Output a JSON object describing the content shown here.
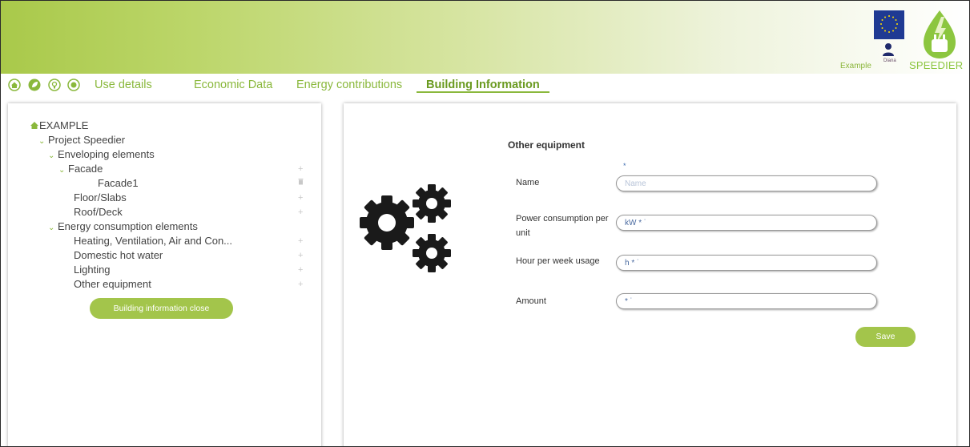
{
  "header": {
    "user_name": "Diana",
    "project_label": "Example",
    "brand_name": "SPEEDIER",
    "colors": {
      "accent": "#8ab83c",
      "button": "#a3c54b",
      "eu_blue": "#1f3a93"
    }
  },
  "nav": {
    "icons": [
      "home-icon",
      "leaf-icon",
      "lightbulb-icon",
      "power-icon"
    ],
    "links": [
      {
        "label": "Use details"
      },
      {
        "label": "Economic Data"
      },
      {
        "label": "Energy contributions"
      },
      {
        "label": "Building Information",
        "active": true
      }
    ]
  },
  "tree": {
    "root": "EXAMPLE",
    "project": "Project Speedier",
    "enveloping": "Enveloping elements",
    "facade": "Facade",
    "facade1": "Facade1",
    "floor": "Floor/Slabs",
    "roof": "Roof/Deck",
    "energy": "Energy consumption elements",
    "hvac": "Heating, Ventilation, Air and Con...",
    "dhw": "Domestic hot water",
    "lighting": "Lighting",
    "other": "Other equipment",
    "add_symbol": "+",
    "close_button": "Building information close"
  },
  "form": {
    "title": "Other equipment",
    "required_mark": "*",
    "fields": [
      {
        "label": "Name",
        "value": "",
        "placeholder": "Name"
      },
      {
        "label": "Power consumption per unit",
        "value": "kW * ˙",
        "placeholder": ""
      },
      {
        "label": "Hour per week usage",
        "value": "h * ˙",
        "placeholder": ""
      },
      {
        "label": "Amount",
        "value": "* ˙",
        "placeholder": ""
      }
    ],
    "save_button": "Save"
  }
}
